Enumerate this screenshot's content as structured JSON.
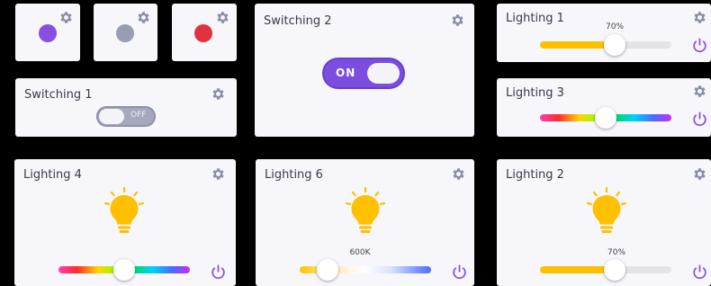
{
  "colors": {
    "accent": "#7b4ee0",
    "gear": "#8a8ea3",
    "purple_dot": "#8a4fe0",
    "gray_dot": "#9a9cb4",
    "red_dot": "#e0323f",
    "bulb": "#ffc000"
  },
  "icons": {
    "gear": "gear-icon",
    "power": "power-icon",
    "bulb": "lightbulb-icon"
  },
  "tiles": [
    {
      "color": "#8a4fe0"
    },
    {
      "color": "#9a9cb4"
    },
    {
      "color": "#e0323f"
    }
  ],
  "switching1": {
    "title": "Switching 1",
    "state_label": "OFF",
    "on": false
  },
  "switching2": {
    "title": "Switching 2",
    "state_label": "ON",
    "on": true
  },
  "lighting1": {
    "title": "Lighting 1",
    "value_label": "70%",
    "level": 0.56
  },
  "lighting3": {
    "title": "Lighting 3",
    "hue_position": 0.5
  },
  "lighting4": {
    "title": "Lighting 4",
    "hue_position": 0.5
  },
  "lighting6": {
    "title": "Lighting 6",
    "value_label": "600K",
    "temp_position": 0.2
  },
  "lighting2": {
    "title": "Lighting 2",
    "value_label": "70%",
    "level": 0.56
  }
}
